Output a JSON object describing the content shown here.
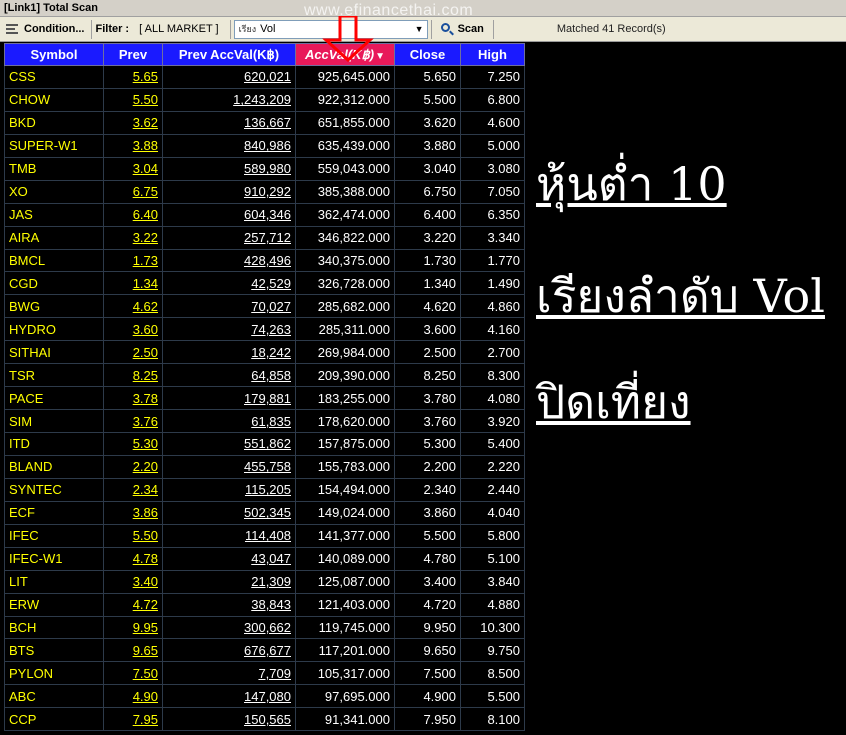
{
  "window": {
    "title": "[Link1] Total Scan"
  },
  "watermark": "www.efinancethai.com",
  "toolbar": {
    "condition_label": "Condition...",
    "filter_label": "Filter :",
    "filter_value": "[ ALL MARKET ]",
    "sort_prefix": "เรียง",
    "sort_value": "Vol",
    "scan_label": "Scan",
    "matched_text": "Matched 41 Record(s)"
  },
  "table": {
    "headers": [
      "Symbol",
      "Prev",
      "Prev AccVal(K฿)",
      "AccVal(K฿)",
      "Close",
      "High"
    ],
    "rows": [
      [
        "CSS",
        "5.65",
        "620,021",
        "925,645.000",
        "5.650",
        "7.250"
      ],
      [
        "CHOW",
        "5.50",
        "1,243,209",
        "922,312.000",
        "5.500",
        "6.800"
      ],
      [
        "BKD",
        "3.62",
        "136,667",
        "651,855.000",
        "3.620",
        "4.600"
      ],
      [
        "SUPER-W1",
        "3.88",
        "840,986",
        "635,439.000",
        "3.880",
        "5.000"
      ],
      [
        "TMB",
        "3.04",
        "589,980",
        "559,043.000",
        "3.040",
        "3.080"
      ],
      [
        "XO",
        "6.75",
        "910,292",
        "385,388.000",
        "6.750",
        "7.050"
      ],
      [
        "JAS",
        "6.40",
        "604,346",
        "362,474.000",
        "6.400",
        "6.350"
      ],
      [
        "AIRA",
        "3.22",
        "257,712",
        "346,822.000",
        "3.220",
        "3.340"
      ],
      [
        "BMCL",
        "1.73",
        "428,496",
        "340,375.000",
        "1.730",
        "1.770"
      ],
      [
        "CGD",
        "1.34",
        "42,529",
        "326,728.000",
        "1.340",
        "1.490"
      ],
      [
        "BWG",
        "4.62",
        "70,027",
        "285,682.000",
        "4.620",
        "4.860"
      ],
      [
        "HYDRO",
        "3.60",
        "74,263",
        "285,311.000",
        "3.600",
        "4.160"
      ],
      [
        "SITHAI",
        "2.50",
        "18,242",
        "269,984.000",
        "2.500",
        "2.700"
      ],
      [
        "TSR",
        "8.25",
        "64,858",
        "209,390.000",
        "8.250",
        "8.300"
      ],
      [
        "PACE",
        "3.78",
        "179,881",
        "183,255.000",
        "3.780",
        "4.080"
      ],
      [
        "SIM",
        "3.76",
        "61,835",
        "178,620.000",
        "3.760",
        "3.920"
      ],
      [
        "ITD",
        "5.30",
        "551,862",
        "157,875.000",
        "5.300",
        "5.400"
      ],
      [
        "BLAND",
        "2.20",
        "455,758",
        "155,783.000",
        "2.200",
        "2.220"
      ],
      [
        "SYNTEC",
        "2.34",
        "115,205",
        "154,494.000",
        "2.340",
        "2.440"
      ],
      [
        "ECF",
        "3.86",
        "502,345",
        "149,024.000",
        "3.860",
        "4.040"
      ],
      [
        "IFEC",
        "5.50",
        "114,408",
        "141,377.000",
        "5.500",
        "5.800"
      ],
      [
        "IFEC-W1",
        "4.78",
        "43,047",
        "140,089.000",
        "4.780",
        "5.100"
      ],
      [
        "LIT",
        "3.40",
        "21,309",
        "125,087.000",
        "3.400",
        "3.840"
      ],
      [
        "ERW",
        "4.72",
        "38,843",
        "121,403.000",
        "4.720",
        "4.880"
      ],
      [
        "BCH",
        "9.95",
        "300,662",
        "119,745.000",
        "9.950",
        "10.300"
      ],
      [
        "BTS",
        "9.65",
        "676,677",
        "117,201.000",
        "9.650",
        "9.750"
      ],
      [
        "PYLON",
        "7.50",
        "7,709",
        "105,317.000",
        "7.500",
        "8.500"
      ],
      [
        "ABC",
        "4.90",
        "147,080",
        "97,695.000",
        "4.900",
        "5.500"
      ],
      [
        "CCP",
        "7.95",
        "150,565",
        "91,341.000",
        "7.950",
        "8.100"
      ]
    ]
  },
  "captions": [
    "หุ้นต่ำ 10",
    "เรียงลำดับ Vol",
    "ปิดเที่ยง"
  ],
  "colors": {
    "header_bg": "#1a1aff",
    "sorted_header_bg": "#e8195a",
    "symbol_text": "#ffff00",
    "value_text": "#ffffff",
    "annotation_arrow": "#ff0000"
  },
  "icons": {
    "condition": "condition-list-icon",
    "dropdown": "chevron-down-icon",
    "scan": "search-icon",
    "sort": "sort-desc-icon",
    "annotation": "red-down-arrow"
  }
}
